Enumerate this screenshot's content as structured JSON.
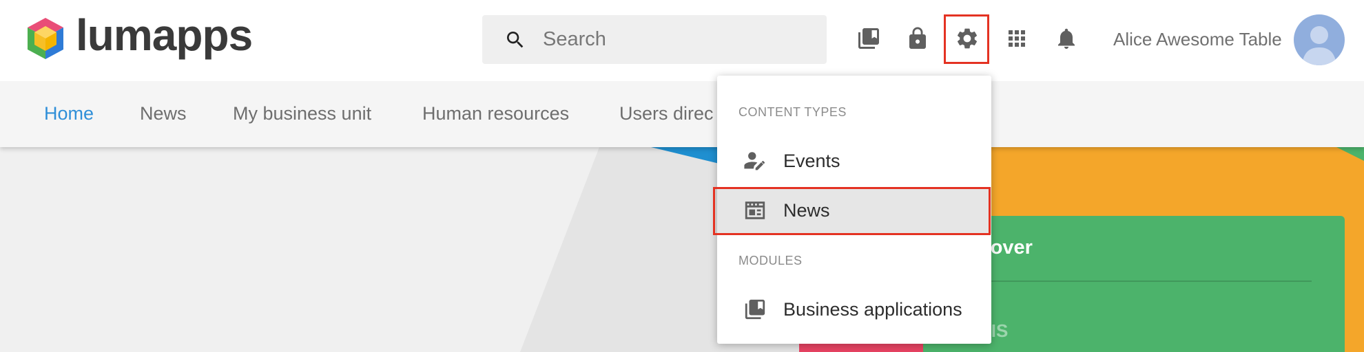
{
  "brand": {
    "name": "lumapps"
  },
  "search": {
    "placeholder": "Search"
  },
  "toolbar": {
    "icons": [
      "library-icon",
      "lock-icon",
      "gear-icon",
      "apps-grid-icon",
      "bell-icon"
    ],
    "highlight_color": "#e43222"
  },
  "user": {
    "name": "Alice Awesome Table"
  },
  "nav": {
    "items": [
      {
        "label": "Home",
        "active": true
      },
      {
        "label": "News"
      },
      {
        "label": "My business unit"
      },
      {
        "label": "Human resources"
      },
      {
        "label": "Users direc"
      }
    ],
    "active_color": "#2f8fd8"
  },
  "dropdown": {
    "sections": [
      {
        "title": "CONTENT TYPES",
        "items": [
          {
            "label": "Events",
            "icon": "person-edit-icon"
          },
          {
            "label": "News",
            "icon": "news-icon",
            "highlighted": true
          }
        ]
      },
      {
        "title": "MODULES",
        "items": [
          {
            "label": "Business applications",
            "icon": "library-icon"
          }
        ]
      }
    ]
  },
  "background_card": {
    "title": "nover",
    "subtitle": "RIS",
    "color": "#4cb36b"
  }
}
